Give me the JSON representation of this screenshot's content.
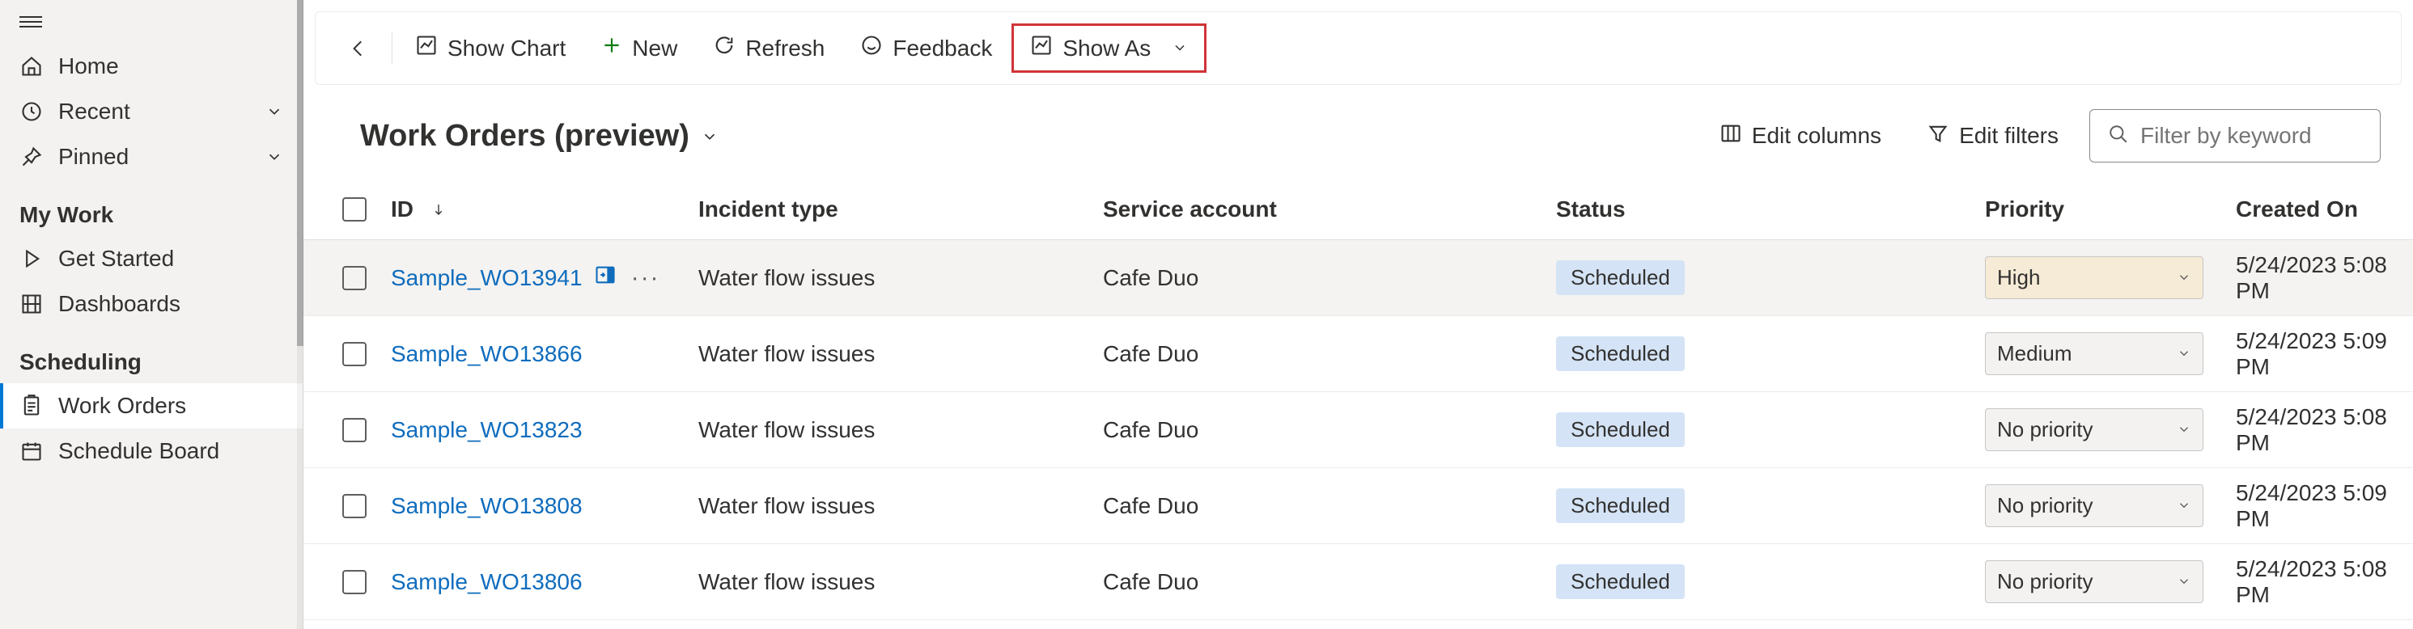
{
  "sidebar": {
    "nav": {
      "home": "Home",
      "recent": "Recent",
      "pinned": "Pinned"
    },
    "sections": [
      {
        "title": "My Work",
        "items": [
          {
            "label": "Get Started",
            "icon": "play"
          },
          {
            "label": "Dashboards",
            "icon": "dashboard"
          }
        ]
      },
      {
        "title": "Scheduling",
        "items": [
          {
            "label": "Work Orders",
            "icon": "clipboard",
            "active": true
          },
          {
            "label": "Schedule Board",
            "icon": "calendar"
          }
        ]
      }
    ]
  },
  "commands": {
    "show_chart": "Show Chart",
    "new": "New",
    "refresh": "Refresh",
    "feedback": "Feedback",
    "show_as": "Show As"
  },
  "view": {
    "title": "Work Orders (preview)",
    "edit_columns": "Edit columns",
    "edit_filters": "Edit filters",
    "filter_placeholder": "Filter by keyword"
  },
  "table": {
    "columns": {
      "id": "ID",
      "incident_type": "Incident type",
      "service_account": "Service account",
      "status": "Status",
      "priority": "Priority",
      "created_on": "Created On"
    },
    "rows": [
      {
        "id": "Sample_WO13941",
        "incident": "Water flow issues",
        "service": "Cafe Duo",
        "status": "Scheduled",
        "priority": "High",
        "priority_cls": "high",
        "created": "5/24/2023 5:08 PM",
        "hovered": true
      },
      {
        "id": "Sample_WO13866",
        "incident": "Water flow issues",
        "service": "Cafe Duo",
        "status": "Scheduled",
        "priority": "Medium",
        "priority_cls": "medium",
        "created": "5/24/2023 5:09 PM"
      },
      {
        "id": "Sample_WO13823",
        "incident": "Water flow issues",
        "service": "Cafe Duo",
        "status": "Scheduled",
        "priority": "No priority",
        "priority_cls": "none",
        "created": "5/24/2023 5:08 PM"
      },
      {
        "id": "Sample_WO13808",
        "incident": "Water flow issues",
        "service": "Cafe Duo",
        "status": "Scheduled",
        "priority": "No priority",
        "priority_cls": "none",
        "created": "5/24/2023 5:09 PM"
      },
      {
        "id": "Sample_WO13806",
        "incident": "Water flow issues",
        "service": "Cafe Duo",
        "status": "Scheduled",
        "priority": "No priority",
        "priority_cls": "none",
        "created": "5/24/2023 5:08 PM"
      }
    ]
  }
}
